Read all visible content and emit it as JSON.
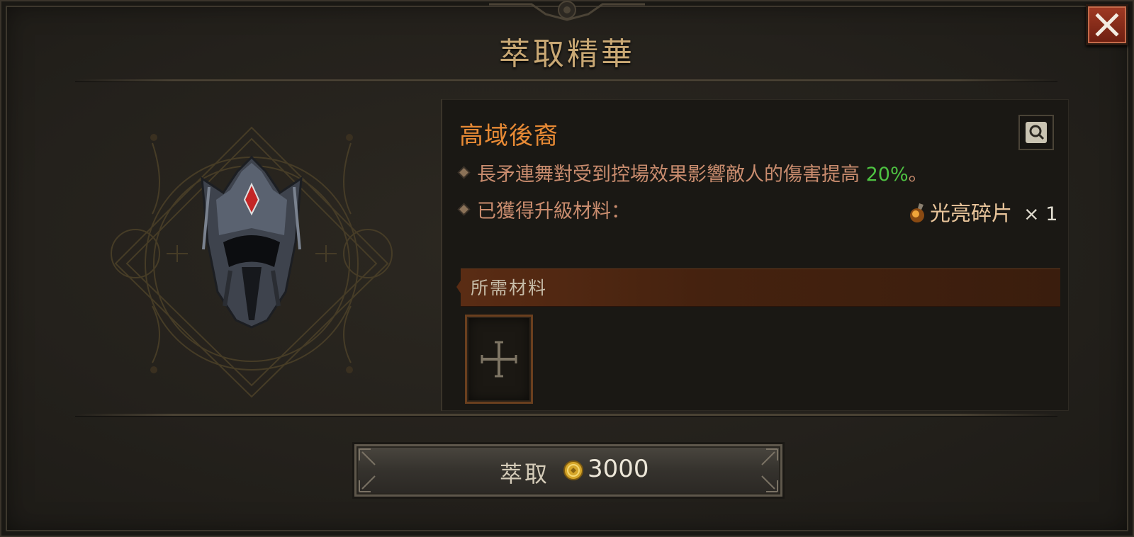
{
  "window": {
    "title": "萃取精華",
    "close_icon": "close-x-icon"
  },
  "emblem": {
    "icon": "helm-aspect-emblem-icon"
  },
  "aspect": {
    "name": "高域後裔",
    "effect_prefix": "長矛連舞對受到控場效果影響敵人的傷害提高 ",
    "effect_value": "20%",
    "effect_suffix": "。",
    "upgrade_label": "已獲得升級材料：",
    "upgrade_material_name": "光亮碎片",
    "upgrade_material_qty": "× 1",
    "inspect_icon": "magnify-scroll-icon"
  },
  "required": {
    "label": "所需材料",
    "slot_icon": "plus-cross-icon"
  },
  "action": {
    "button_label": "萃取",
    "cost": "3000",
    "cost_icon": "gold-coin-icon"
  },
  "colors": {
    "accent_orange": "#e88a35",
    "value_green": "#4ec242",
    "title_gold": "#c9a874",
    "close_red": "#a13a24"
  }
}
